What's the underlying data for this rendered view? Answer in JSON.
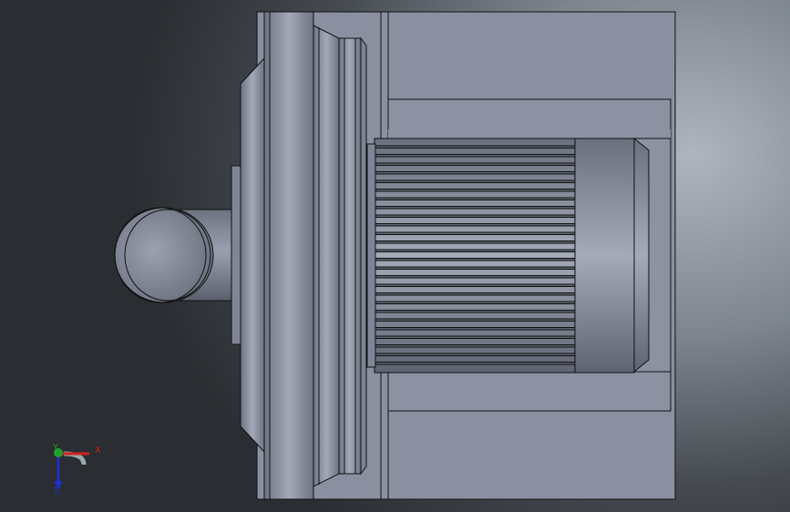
{
  "viewport": {
    "background_top": "#aeb5bd",
    "background_dark": "#2a2d31"
  },
  "model": {
    "part_color": "#8a91a1",
    "edge_color": "#111111"
  },
  "triad": {
    "x_label": "X",
    "y_label": "Y",
    "z_label": "Z",
    "x_color": "#d42020",
    "y_color": "#20a030",
    "z_color": "#2030c0"
  }
}
